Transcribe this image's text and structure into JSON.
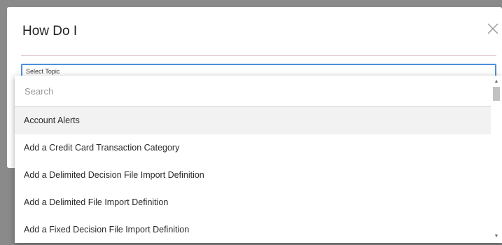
{
  "modal": {
    "title": "How Do I"
  },
  "topic_select": {
    "label": "Select Topic"
  },
  "dropdown": {
    "search_placeholder": "Search",
    "options": [
      {
        "label": "Account Alerts",
        "highlighted": true
      },
      {
        "label": "Add a Credit Card Transaction Category"
      },
      {
        "label": "Add a Delimited Decision File Import Definition"
      },
      {
        "label": "Add a Delimited File Import Definition"
      },
      {
        "label": "Add a Fixed Decision File Import Definition"
      }
    ],
    "scroll_position": 0.0
  },
  "icons": {
    "close": "close-icon",
    "scroll_up": "triangle-up-icon",
    "scroll_down": "triangle-down-icon"
  },
  "colors": {
    "accent": "#4a90d9",
    "overlay": "#8a8a8a",
    "highlight": "#f2f2f2",
    "divider": "#e0c8cc"
  }
}
